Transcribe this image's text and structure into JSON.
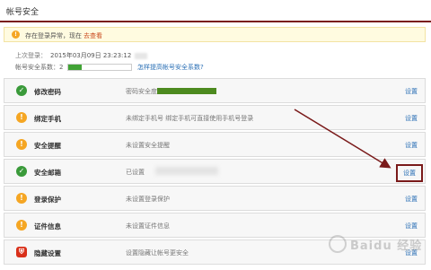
{
  "header": {
    "title": "帐号安全"
  },
  "notice": {
    "text": "存在登录异常，现在",
    "link": "去查看"
  },
  "last_login": {
    "label": "上次登录：",
    "datetime": "2015年03月09日  23:23:12"
  },
  "security_score": {
    "label": "帐号安全系数：2",
    "fill_percent": 22,
    "link": "怎样提高帐号安全系数?"
  },
  "items": [
    {
      "title": "修改密码",
      "desc": "密码安全度",
      "action": "设置",
      "status": "ok"
    },
    {
      "title": "绑定手机",
      "desc": "未绑定手机号 绑定手机可直接使用手机号登录",
      "action": "设置",
      "status": "warn"
    },
    {
      "title": "安全提醒",
      "desc": "未设置安全提醒",
      "action": "设置",
      "status": "warn"
    },
    {
      "title": "安全邮箱",
      "desc": "已设置",
      "action": "设置",
      "status": "ok"
    },
    {
      "title": "登录保护",
      "desc": "未设置登录保护",
      "action": "设置",
      "status": "warn"
    },
    {
      "title": "证件信息",
      "desc": "未设置证件信息",
      "action": "设置",
      "status": "warn"
    },
    {
      "title": "隐藏设置",
      "desc": "设置隐藏让帐号更安全",
      "action": "设置",
      "status": "danger"
    }
  ],
  "icons": {
    "ok": "check-icon",
    "warn": "exclamation-icon",
    "danger": "shield-icon"
  },
  "colors": {
    "accent": "#7a1a1a",
    "link": "#2a6fb5",
    "ok": "#3a9a3a",
    "warn": "#f5a623",
    "danger": "#d9301a"
  },
  "watermark": {
    "text": "Baidu 经验"
  }
}
